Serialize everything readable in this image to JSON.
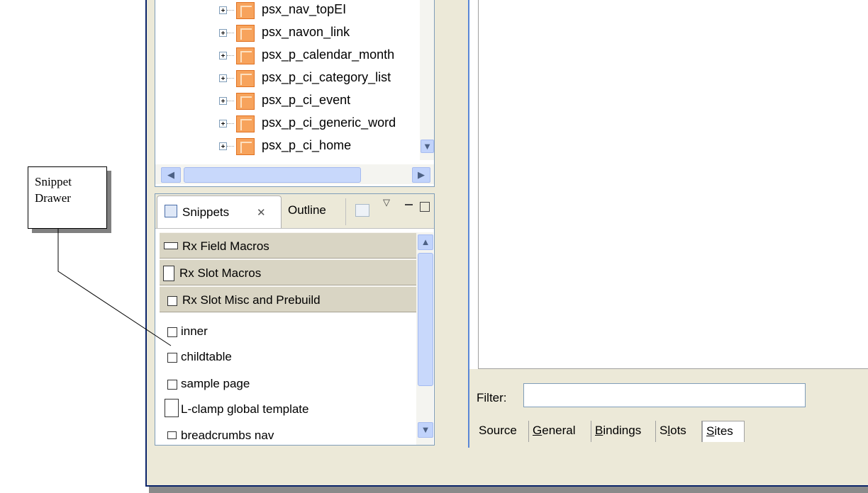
{
  "callout": {
    "line1": "Snippet",
    "line2": "Drawer"
  },
  "tree": {
    "items": [
      "psx_nav_topEI",
      "psx_navon_link",
      "psx_p_calendar_month",
      "psx_p_ci_category_list",
      "psx_p_ci_event",
      "psx_p_ci_generic_word",
      "psx_p_ci_home"
    ]
  },
  "snippets_view": {
    "tabs": {
      "snippets": "Snippets",
      "outline": "Outline"
    },
    "drawers": [
      "Rx Field Macros",
      "Rx Slot Macros",
      "Rx Slot Misc and Prebuild"
    ],
    "items": [
      "inner",
      "childtable",
      "sample page",
      "L-clamp global template",
      "breadcrumbs nav"
    ]
  },
  "editor": {
    "filter_label": "Filter:",
    "filter_value": "",
    "tabs": {
      "source": "Source",
      "general_g": "G",
      "general_rest": "eneral",
      "bindings_b": "B",
      "bindings_rest": "indings",
      "slots_s": "S",
      "slots_l": "l",
      "slots_rest": "ots",
      "sites_s": "S",
      "sites_rest": "ites"
    },
    "active_tab": "Sites"
  },
  "colors": {
    "accent": "#5a87d6",
    "drawer": "#d9d5c4",
    "chrome": "#ece9d8"
  }
}
